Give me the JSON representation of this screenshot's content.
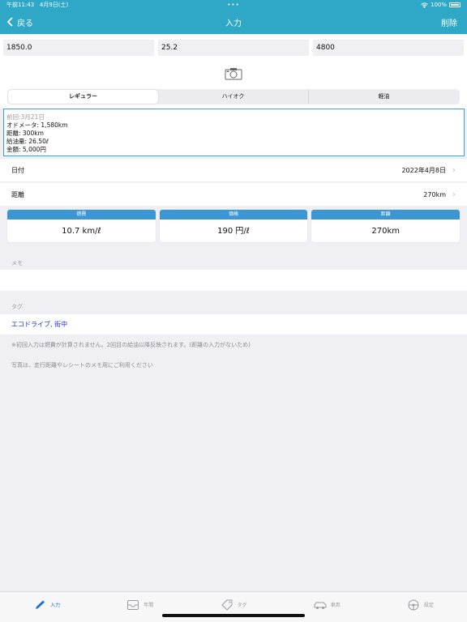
{
  "status": {
    "time": "午前11:43",
    "date": "4月9日(土)",
    "dots": "•••",
    "battery": "100%"
  },
  "nav": {
    "back": "戻る",
    "title": "入力",
    "delete": "削除"
  },
  "inputs": {
    "odometer": "1850.0",
    "amount": "25.2",
    "price": "4800"
  },
  "fuel_types": [
    "レギュラー",
    "ハイオク",
    "軽油"
  ],
  "selected_fuel": "レギュラー",
  "previous": {
    "date": "前回:3月21日",
    "odometer": "オドメータ: 1,580km",
    "distance": "距離: 300km",
    "fuel": "給油量: 26.50ℓ",
    "cost": "金額: 5,000円"
  },
  "date_row": {
    "label": "日付",
    "value": "2022年4月8日"
  },
  "distance_row": {
    "label": "距離",
    "value": "270km"
  },
  "stats": [
    {
      "title": "燃費",
      "value": "10.7 km/ℓ"
    },
    {
      "title": "価格",
      "value": "190 円/ℓ"
    },
    {
      "title": "距離",
      "value": "270km"
    }
  ],
  "memo": {
    "label": "メモ",
    "value": ""
  },
  "tags": {
    "label": "タグ",
    "value": "エコドライブ, 街中"
  },
  "notes": {
    "first": "※初回入力は燃費が計算されません。2回目の給油以降反映されます。(距離の入力がないため)",
    "photo": "写真は、走行距離やレシートのメモ用にご利用ください"
  },
  "tabs": [
    {
      "label": "入力",
      "icon": "pencil-icon"
    },
    {
      "label": "年間",
      "icon": "inbox-icon"
    },
    {
      "label": "タグ",
      "icon": "tag-icon"
    },
    {
      "label": "車両",
      "icon": "car-icon"
    },
    {
      "label": "設定",
      "icon": "steering-wheel-icon"
    }
  ],
  "colors": {
    "accent": "#2fa7c6",
    "stat_header": "#3a97d3",
    "tag_text": "#1e30c8",
    "active_tab": "#1e6fd0"
  }
}
